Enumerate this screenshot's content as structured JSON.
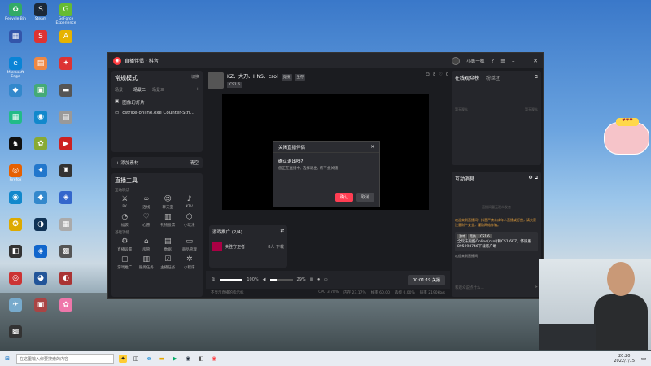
{
  "desktop": {
    "icons": [
      {
        "label": "Recycle Bin",
        "glyph": "♻",
        "color": "#3a6"
      },
      {
        "label": "Steam",
        "glyph": "S",
        "color": "#1b2838"
      },
      {
        "label": "GeForce Experience",
        "glyph": "G",
        "color": "#6b3"
      },
      {
        "label": "",
        "glyph": "▦",
        "color": "#35a"
      },
      {
        "label": "",
        "glyph": "S",
        "color": "#d33"
      },
      {
        "label": "",
        "glyph": "A",
        "color": "#e6b300"
      },
      {
        "label": "Microsoft Edge",
        "glyph": "e",
        "color": "#0a84d6"
      },
      {
        "label": "",
        "glyph": "▤",
        "color": "#e84"
      },
      {
        "label": "",
        "glyph": "✦",
        "color": "#d33"
      },
      {
        "label": "",
        "glyph": "◆",
        "color": "#38c"
      },
      {
        "label": "",
        "glyph": "▣",
        "color": "#4a7"
      },
      {
        "label": "",
        "glyph": "▬",
        "color": "#555"
      },
      {
        "label": "",
        "glyph": "▦",
        "color": "#2b8"
      },
      {
        "label": "",
        "glyph": "◉",
        "color": "#18c"
      },
      {
        "label": "",
        "glyph": "▤",
        "color": "#999"
      },
      {
        "label": "",
        "glyph": "♞",
        "color": "#111"
      },
      {
        "label": "",
        "glyph": "✿",
        "color": "#8a3"
      },
      {
        "label": "",
        "glyph": "▶",
        "color": "#c22"
      },
      {
        "label": "Firefox",
        "glyph": "◎",
        "color": "#e66000"
      },
      {
        "label": "",
        "glyph": "✦",
        "color": "#27c"
      },
      {
        "label": "",
        "glyph": "♜",
        "color": "#333"
      },
      {
        "label": "",
        "glyph": "◉",
        "color": "#18c"
      },
      {
        "label": "",
        "glyph": "◆",
        "color": "#38c"
      },
      {
        "label": "",
        "glyph": "◈",
        "color": "#36c"
      },
      {
        "label": "",
        "glyph": "✪",
        "color": "#da0"
      },
      {
        "label": "",
        "glyph": "◑",
        "color": "#135"
      },
      {
        "label": "",
        "glyph": "▦",
        "color": "#aaa"
      },
      {
        "label": "",
        "glyph": "◧",
        "color": "#333"
      },
      {
        "label": "",
        "glyph": "◈",
        "color": "#16c"
      },
      {
        "label": "",
        "glyph": "▩",
        "color": "#555"
      },
      {
        "label": "",
        "glyph": "◎",
        "color": "#c33"
      },
      {
        "label": "",
        "glyph": "◕",
        "color": "#259"
      },
      {
        "label": "",
        "glyph": "◐",
        "color": "#a33"
      },
      {
        "label": "",
        "glyph": "✈",
        "color": "#7ac"
      },
      {
        "label": "",
        "glyph": "▣",
        "color": "#a44"
      },
      {
        "label": "",
        "glyph": "✿",
        "color": "#e7a"
      },
      {
        "label": "",
        "glyph": "▩",
        "color": "#333"
      }
    ]
  },
  "app": {
    "title": "直播伴侣 · 抖音",
    "username": "小彰一枫",
    "accent": "#ff3d52"
  },
  "left": {
    "mode_title": "常规模式",
    "mode_switch": "切换",
    "scenes": [
      "场景一",
      "场景二",
      "场景三"
    ],
    "sources": [
      "图像幻灯片",
      "cstrike-online.exe Counter-Stri..."
    ],
    "add_material": "+ 添加素材",
    "clear": "清空",
    "tools_title": "直播工具",
    "tools_sub1": "互动玩法",
    "tools_row1": [
      {
        "label": "PK",
        "glyph": "⚔"
      },
      {
        "label": "连线",
        "glyph": "∞"
      },
      {
        "label": "聊天室",
        "glyph": "☺"
      },
      {
        "label": "KTV",
        "glyph": "♪"
      }
    ],
    "tools_row2": [
      {
        "label": "福袋",
        "glyph": "◔"
      },
      {
        "label": "心愿",
        "glyph": "♡"
      },
      {
        "label": "礼物投票",
        "glyph": "▥"
      },
      {
        "label": "小玩法",
        "glyph": "⬡"
      }
    ],
    "tools_sub2": "基础功能",
    "tools_row3": [
      {
        "label": "直播设置",
        "glyph": "⚙"
      },
      {
        "label": "房管",
        "glyph": "⌂"
      },
      {
        "label": "数据",
        "glyph": "▤"
      },
      {
        "label": "商品管理",
        "glyph": "▭"
      }
    ],
    "tools_row4": [
      {
        "label": "游戏推广",
        "glyph": "▢"
      },
      {
        "label": "服务任务",
        "glyph": "▥"
      },
      {
        "label": "主播任务",
        "glyph": "☑"
      },
      {
        "label": "小程序",
        "glyph": "✲"
      }
    ]
  },
  "mid": {
    "anchor_name": "KZ、大刀、HNS、csol",
    "tags": [
      "竞技",
      "生存"
    ],
    "category": "CS1.6",
    "counts": [
      "8",
      "0"
    ],
    "dialog": {
      "title": "关闭直播伴侣",
      "question": "确认退出吗?",
      "desc": "您正在直播中, 选择退出, 将不会关播",
      "ok": "确认",
      "cancel": "取消"
    },
    "promo_title": "游戏推广 (2/4)",
    "promo_item": "决胜守卫者",
    "promo_count": "8人 下载",
    "volume1": "100%",
    "volume2": "29%",
    "timer": "00:01:19 关播",
    "status": [
      "不显示直播的指示标",
      "CPU 3.78%",
      "内存 23.17%",
      "帧率 60.00",
      "丢帧 0.00%",
      "码率 2190kb/s"
    ]
  },
  "right": {
    "tab1": "在线观众榜",
    "tab2": "粉丝团",
    "empty_left": "暂无观众",
    "empty_right": "暂无观众",
    "msg_title": "互动消息",
    "hint": "直播间暂无观众发言",
    "warn": "欢迎来到直播间！抖音严禁未成年人直播或打赏，请大家注意财产安全，谨防网络诈骗。",
    "chips": [
      "游戏",
      "竞技",
      "CS1.6"
    ],
    "bubble": "全玩法跑酷Online(csol)和CS1.6KZ，怀旧服895998746下载客户端",
    "me": "欢迎来到直播间",
    "input_placeholder": "和观众说点什么..."
  },
  "taskbar": {
    "search_placeholder": "在这里输入你要搜索的内容",
    "time": "20:20",
    "date": "2022/7/15"
  }
}
